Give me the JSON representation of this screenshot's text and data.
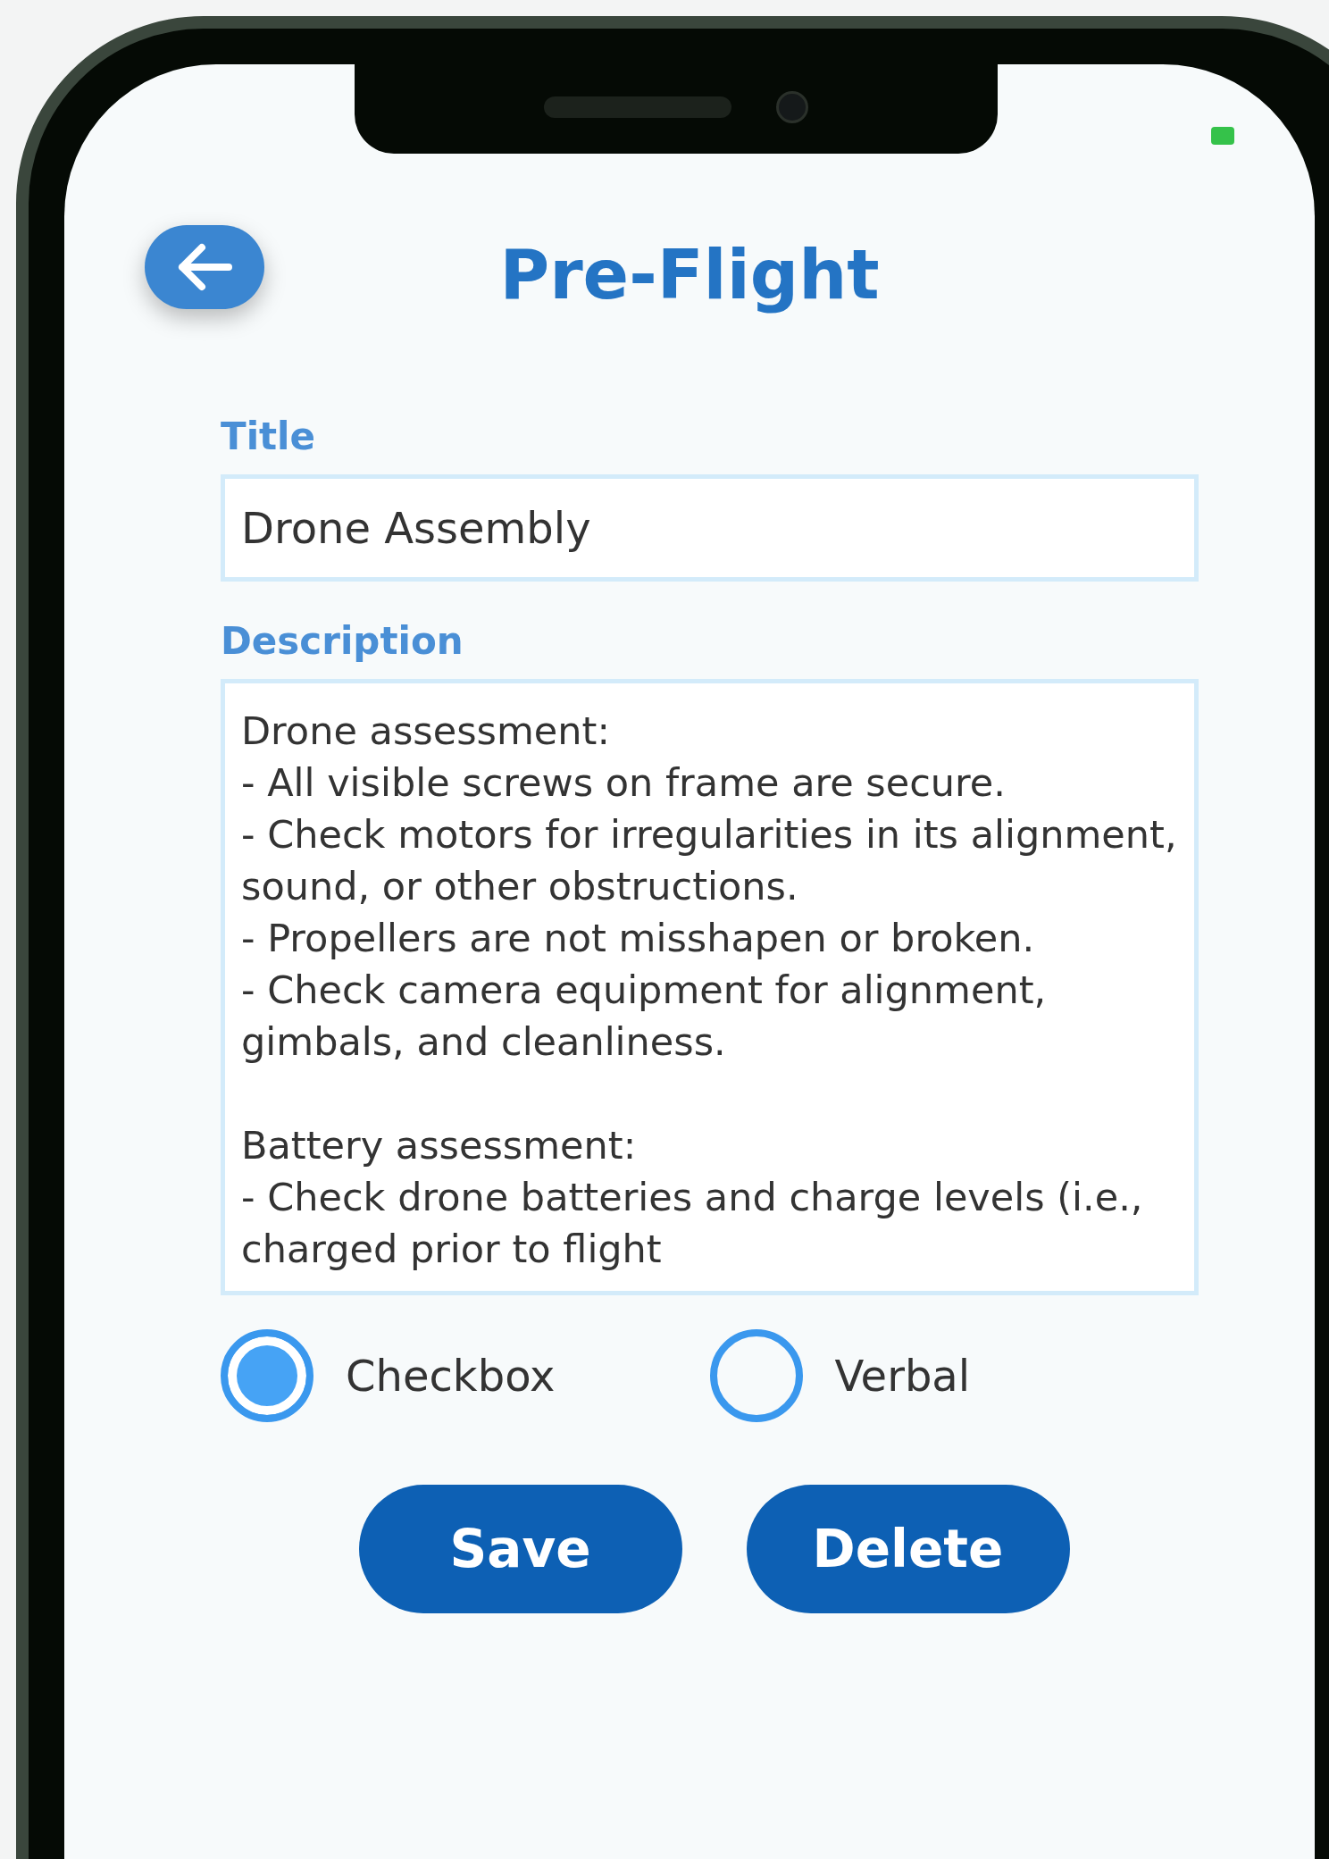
{
  "header": {
    "title": "Pre-Flight"
  },
  "form": {
    "title_label": "Title",
    "title_value": "Drone Assembly",
    "description_label": "Description",
    "description_paragraphs": [
      [
        "Drone assessment:",
        "- All visible screws on frame are secure.",
        "- Check motors for irregularities in its alignment, sound, or other obstructions.",
        "- Propellers are not misshapen or broken.",
        "- Check camera equipment for alignment, gimbals, and cleanliness."
      ],
      [
        "Battery assessment:",
        "- Check drone batteries and charge levels (i.e., charged prior to flight"
      ]
    ]
  },
  "options": [
    {
      "label": "Checkbox",
      "selected": true
    },
    {
      "label": "Verbal",
      "selected": false
    }
  ],
  "buttons": [
    "Save",
    "Delete"
  ]
}
